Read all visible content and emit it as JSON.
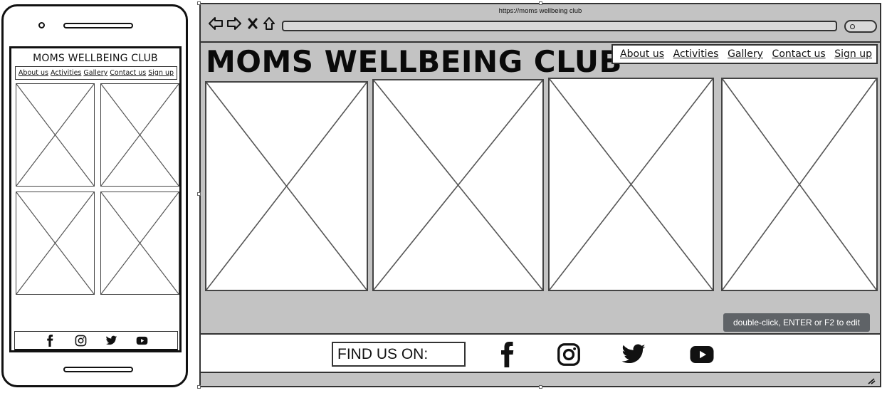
{
  "mobile": {
    "title": "MOMS WELLBEING CLUB",
    "nav_items": [
      "About us",
      "Activities",
      "Gallery",
      "Contact us",
      "Sign up"
    ],
    "social_icons": [
      "facebook-icon",
      "instagram-icon",
      "twitter-icon",
      "youtube-icon"
    ]
  },
  "browser": {
    "url": "https://moms wellbeing club"
  },
  "desktop": {
    "title": "MOMS WELLBEING CLUB",
    "nav": {
      "about": "About us",
      "activities": "Activities",
      "gallery": "Gallery",
      "contact": "Contact us",
      "signup": "Sign up"
    },
    "footer_label": "FIND US ON:",
    "social_icons": [
      "facebook-icon",
      "instagram-icon",
      "twitter-icon",
      "youtube-icon"
    ]
  },
  "editor_hint": "double-click, ENTER or F2 to edit",
  "colors": {
    "browser_background": "#c3c3c3",
    "tooltip_background": "#5f6367",
    "stroke": "#333333"
  }
}
